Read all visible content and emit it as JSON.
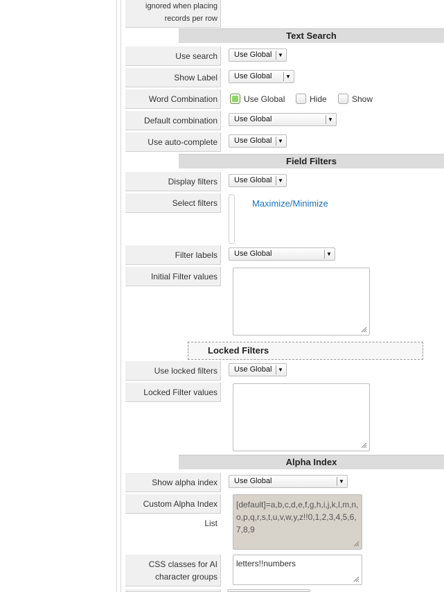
{
  "top_note": {
    "line1": "ignored when placing",
    "line2": "records per row"
  },
  "sections": {
    "text_search": "Text Search",
    "field_filters": "Field Filters",
    "locked_filters": "Locked Filters",
    "alpha_index": "Alpha Index"
  },
  "labels": {
    "use_search": "Use search",
    "show_label": "Show Label",
    "word_combination": "Word Combination",
    "default_combination": "Default combination",
    "use_autocomplete": "Use auto-complete",
    "display_filters": "Display filters",
    "select_filters": "Select filters",
    "filter_labels": "Filter labels",
    "initial_filter_values": "Initial Filter values",
    "use_locked_filters": "Use locked filters",
    "locked_filter_values": "Locked Filter values",
    "show_alpha_index": "Show alpha index",
    "custom_alpha_index_list": "Custom Alpha Index List",
    "css_classes_line1": "CSS classes for AI",
    "css_classes_line2": "character groups"
  },
  "values": {
    "use_search": "Use Global",
    "show_label": "Use Global",
    "default_combination": "Use Global",
    "use_autocomplete": "Use Global",
    "display_filters": "Use Global",
    "filter_labels": "Use Global",
    "initial_filter_values": "",
    "use_locked_filters": "Use Global",
    "locked_filter_values": "",
    "show_alpha_index": "Use Global",
    "custom_alpha_index_list": "[default]=a,b,c,d,e,f,g,h,i,j,k,l,m,n,o,p,q,r,s,t,u,v,w,y,z!!0,1,2,3,4,5,6,7,8,9",
    "css_classes": "letters!!numbers"
  },
  "word_combination_options": {
    "use_global": "Use Global",
    "hide": "Hide",
    "show": "Show",
    "selected": "use_global"
  },
  "select_filters_link": "Maximize/Minimize",
  "icons": {
    "dropdown": "dropdown-arrow-icon",
    "resize": "resize-grip-icon"
  },
  "colors": {
    "link": "#1a70b8",
    "section_bg": "#dcdcdc",
    "label_bg": "#f0f0f0",
    "checked": "#8fd36a",
    "disabled_textarea": "#d8d3ca"
  }
}
